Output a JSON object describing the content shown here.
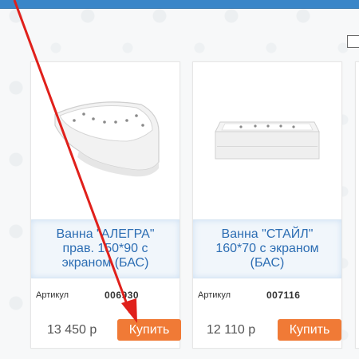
{
  "products": [
    {
      "title": "Ванна \"АЛЕГРА\" прав. 150*90 с экраном (БАС)",
      "article_label": "Артикул",
      "article": "006930",
      "price": "13 450 р",
      "buy_label": "Купить"
    },
    {
      "title": "Ванна \"СТАЙЛ\" 160*70 с экраном (БАС)",
      "article_label": "Артикул",
      "article": "007116",
      "price": "12 110 р",
      "buy_label": "Купить"
    }
  ],
  "colors": {
    "header": "#3a86c8",
    "title": "#2c6db3",
    "buy_button": "#f07a36",
    "annotation_arrow": "#e0201b"
  }
}
